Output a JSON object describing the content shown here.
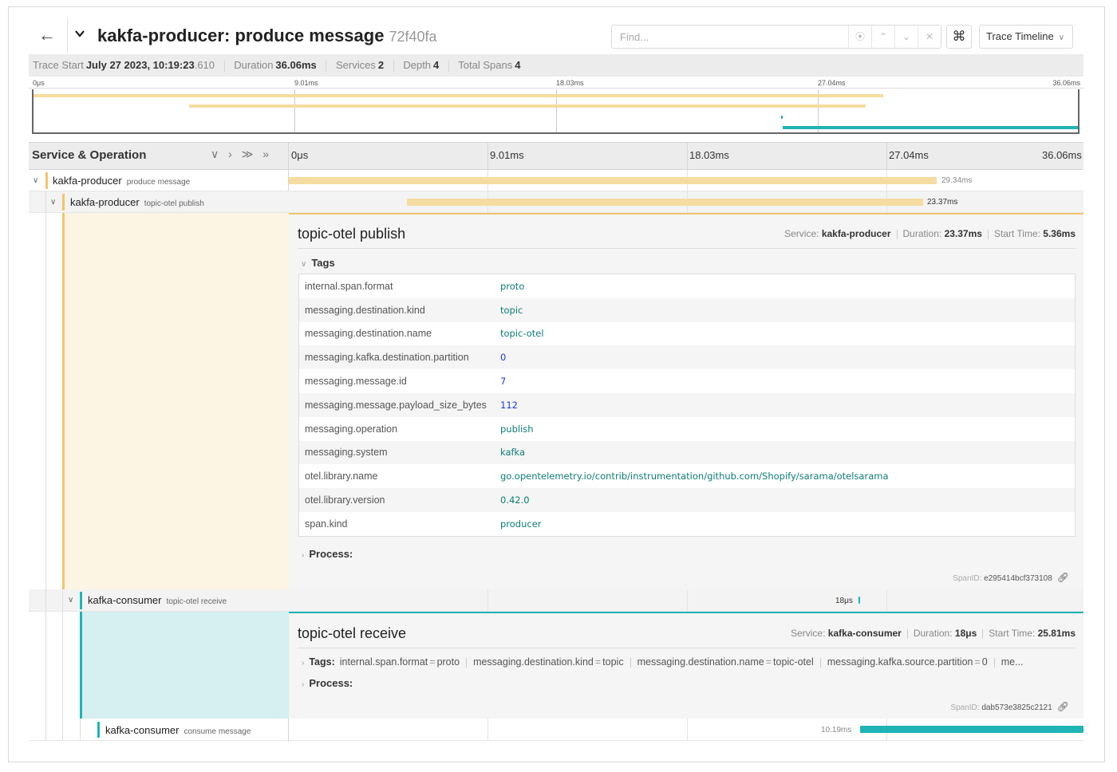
{
  "header": {
    "title": "kakfa-producer: produce message",
    "trace_id": "72f40fa",
    "search_placeholder": "Find...",
    "find_buttons": [
      "⦿",
      "⌃",
      "⌄",
      "✕"
    ],
    "shortcut_glyph": "⌘",
    "view_select": "Trace Timeline"
  },
  "meta": {
    "trace_start_label": "Trace Start",
    "trace_start_value": "July 27 2023, 10:19:23",
    "trace_start_ms": ".610",
    "duration_label": "Duration",
    "duration_value": "36.06ms",
    "services_label": "Services",
    "services_value": "2",
    "depth_label": "Depth",
    "depth_value": "4",
    "total_spans_label": "Total Spans",
    "total_spans_value": "4"
  },
  "minimap_ticks": [
    "0μs",
    "9.01ms",
    "18.03ms",
    "27.04ms",
    "36.06ms"
  ],
  "columns": {
    "service_operation": "Service & Operation",
    "controls": "∨ › ≫ »",
    "ticks": [
      "0μs",
      "9.01ms",
      "18.03ms",
      "27.04ms",
      "36.06ms"
    ]
  },
  "spans": [
    {
      "service": "kakfa-producer",
      "operation": "produce message",
      "duration_label": "29.34ms",
      "color": "#f5dca0",
      "start_ms": 0,
      "duration_ms": 29.34
    },
    {
      "service": "kakfa-producer",
      "operation": "topic-otel publish",
      "duration_label": "23.37ms",
      "color": "#f5dca0",
      "start_ms": 5.36,
      "duration_ms": 23.37
    },
    {
      "service": "kafka-consumer",
      "operation": "topic-otel receive",
      "duration_label": "18μs",
      "color": "#1fb4b4",
      "start_ms": 25.81,
      "duration_ms": 0.018
    },
    {
      "service": "kafka-consumer",
      "operation": "consume message",
      "duration_label": "10.19ms",
      "color": "#1fb4b4",
      "start_ms": 25.87,
      "duration_ms": 10.19
    }
  ],
  "detail_publish": {
    "title": "topic-otel publish",
    "service_label": "Service:",
    "service": "kakfa-producer",
    "duration_label": "Duration:",
    "duration": "23.37ms",
    "start_label": "Start Time:",
    "start": "5.36ms",
    "tags_label": "Tags",
    "tags": [
      {
        "key": "internal.span.format",
        "value": "proto"
      },
      {
        "key": "messaging.destination.kind",
        "value": "topic"
      },
      {
        "key": "messaging.destination.name",
        "value": "topic-otel"
      },
      {
        "key": "messaging.kafka.destination.partition",
        "value": "0"
      },
      {
        "key": "messaging.message.id",
        "value": "7"
      },
      {
        "key": "messaging.message.payload_size_bytes",
        "value": "112"
      },
      {
        "key": "messaging.operation",
        "value": "publish"
      },
      {
        "key": "messaging.system",
        "value": "kafka"
      },
      {
        "key": "otel.library.name",
        "value": "go.opentelemetry.io/contrib/instrumentation/github.com/Shopify/sarama/otelsarama"
      },
      {
        "key": "otel.library.version",
        "value": "0.42.0"
      },
      {
        "key": "span.kind",
        "value": "producer"
      }
    ],
    "process_label": "Process:",
    "spanid_label": "SpanID:",
    "spanid": "e295414bcf373108"
  },
  "detail_receive": {
    "title": "topic-otel receive",
    "service_label": "Service:",
    "service": "kafka-consumer",
    "duration_label": "Duration:",
    "duration": "18μs",
    "start_label": "Start Time:",
    "start": "25.81ms",
    "tags_label": "Tags:",
    "inline_tags": [
      {
        "key": "internal.span.format",
        "value": "proto"
      },
      {
        "key": "messaging.destination.kind",
        "value": "topic"
      },
      {
        "key": "messaging.destination.name",
        "value": "topic-otel"
      },
      {
        "key": "messaging.kafka.source.partition",
        "value": "0"
      }
    ],
    "inline_more": "me...",
    "process_label": "Process:",
    "spanid_label": "SpanID:",
    "spanid": "dab573e3825c2121"
  },
  "colors": {
    "producer": "#f5dca0",
    "consumer": "#1fb4b4",
    "producer_accent": "#f2c46d"
  }
}
